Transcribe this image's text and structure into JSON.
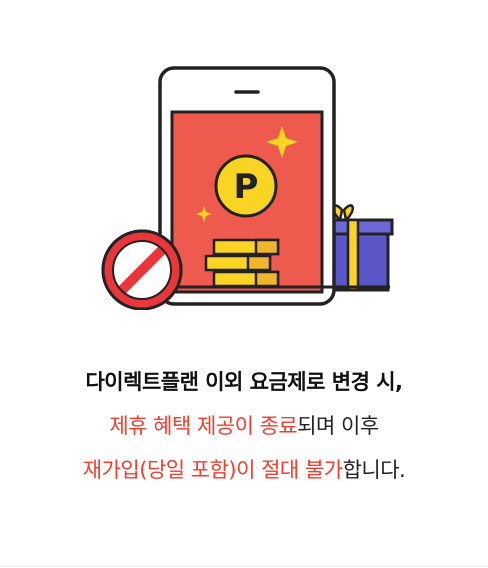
{
  "notice": {
    "headline": "다이렉트플랜 이외 요금제로 변경 시,",
    "line2_accent": "제휴 혜택 제공이 종료",
    "line2_plain": "되며 이후",
    "line3_accent": "재가입(당일 포함)이 절대 불가",
    "line3_plain": "합니다."
  },
  "illustration": {
    "coin_letter": "P",
    "colors": {
      "phone_screen": "#ee5a4d",
      "coin": "#f9d423",
      "gift_box": "#5a56c8",
      "gift_ribbon": "#f9d423",
      "no_sign": "#e8363b",
      "accent_text": "#ee3e2f"
    }
  }
}
